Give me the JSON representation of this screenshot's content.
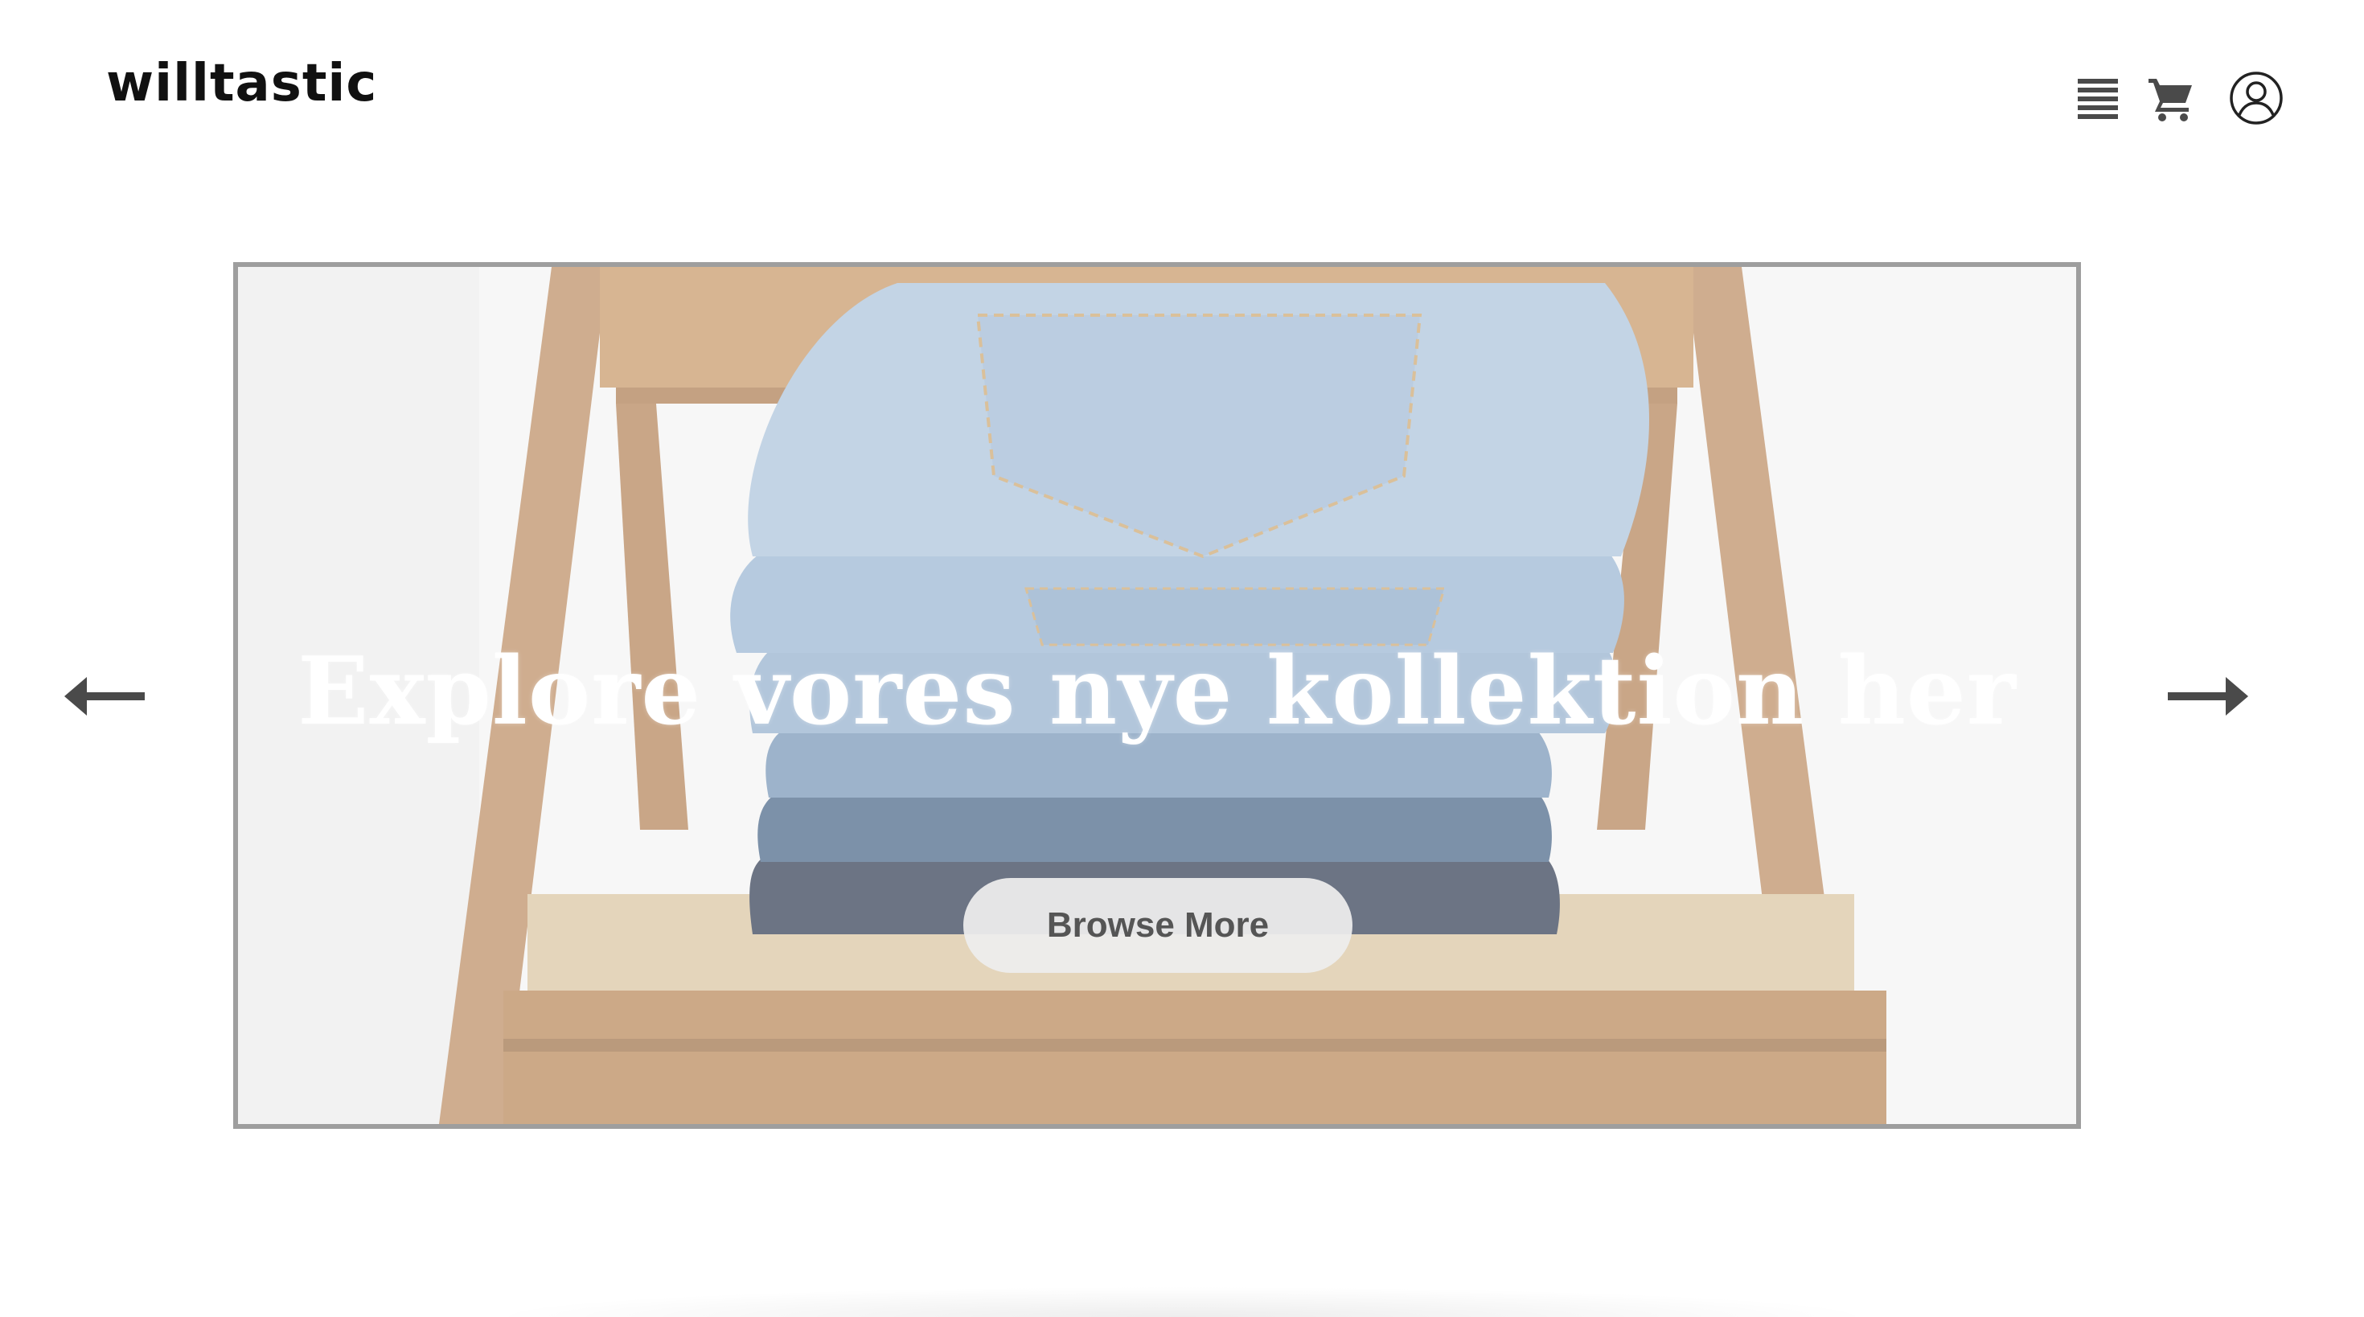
{
  "header": {
    "logo_text": "willtastic",
    "icons": {
      "menu": "menu-icon",
      "cart": "cart-icon",
      "account": "account-icon"
    }
  },
  "hero": {
    "title": "Explore vores nye kollektion her",
    "button_label": "Browse More",
    "prev_icon": "arrow-left-icon",
    "next_icon": "arrow-right-icon",
    "image": "stack-of-folded-jeans-on-wooden-chair"
  },
  "colors": {
    "logo": "#111111",
    "icons": "#4a4a4a",
    "frame_border": "#9e9e9e",
    "button_bg": "#eeeeee",
    "button_text": "#555555"
  }
}
